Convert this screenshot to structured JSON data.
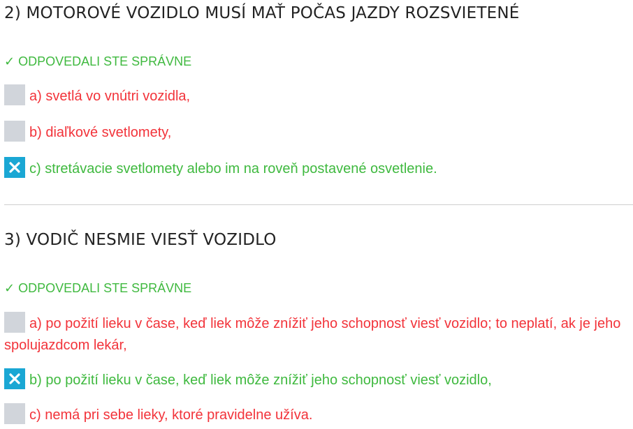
{
  "questions": [
    {
      "title": "2) MOTOROVÉ VOZIDLO MUSÍ MAŤ POČAS JAZDY ROZSVIETENÉ",
      "status": "✓ ODPOVEDALI STE SPRÁVNE",
      "answers": [
        {
          "text": "a) svetlá vo vnútri vozidla,",
          "checked": false,
          "correct": false
        },
        {
          "text": "b) diaľkové svetlomety,",
          "checked": false,
          "correct": false
        },
        {
          "text": "c) stretávacie svetlomety alebo im na roveň postavené osvetlenie.",
          "checked": true,
          "correct": true
        }
      ]
    },
    {
      "title": "3) VODIČ NESMIE VIESŤ VOZIDLO",
      "status": "✓ ODPOVEDALI STE SPRÁVNE",
      "answers": [
        {
          "text": "a) po požití lieku v čase, keď liek môže znížiť jeho schopnosť viesť vozidlo; to neplatí, ak je jeho spolujazdcom lekár,",
          "checked": false,
          "correct": false
        },
        {
          "text": "b) po požití lieku v čase, keď liek môže znížiť jeho schopnosť viesť vozidlo,",
          "checked": true,
          "correct": true
        },
        {
          "text": "c) nemá pri sebe lieky, ktoré pravidelne užíva.",
          "checked": false,
          "correct": false
        }
      ]
    }
  ],
  "colors": {
    "correct": "#3fb93f",
    "wrong": "#f2333a",
    "checkbox": "#d1d5db",
    "checkbox_checked": "#1aa7d4"
  }
}
